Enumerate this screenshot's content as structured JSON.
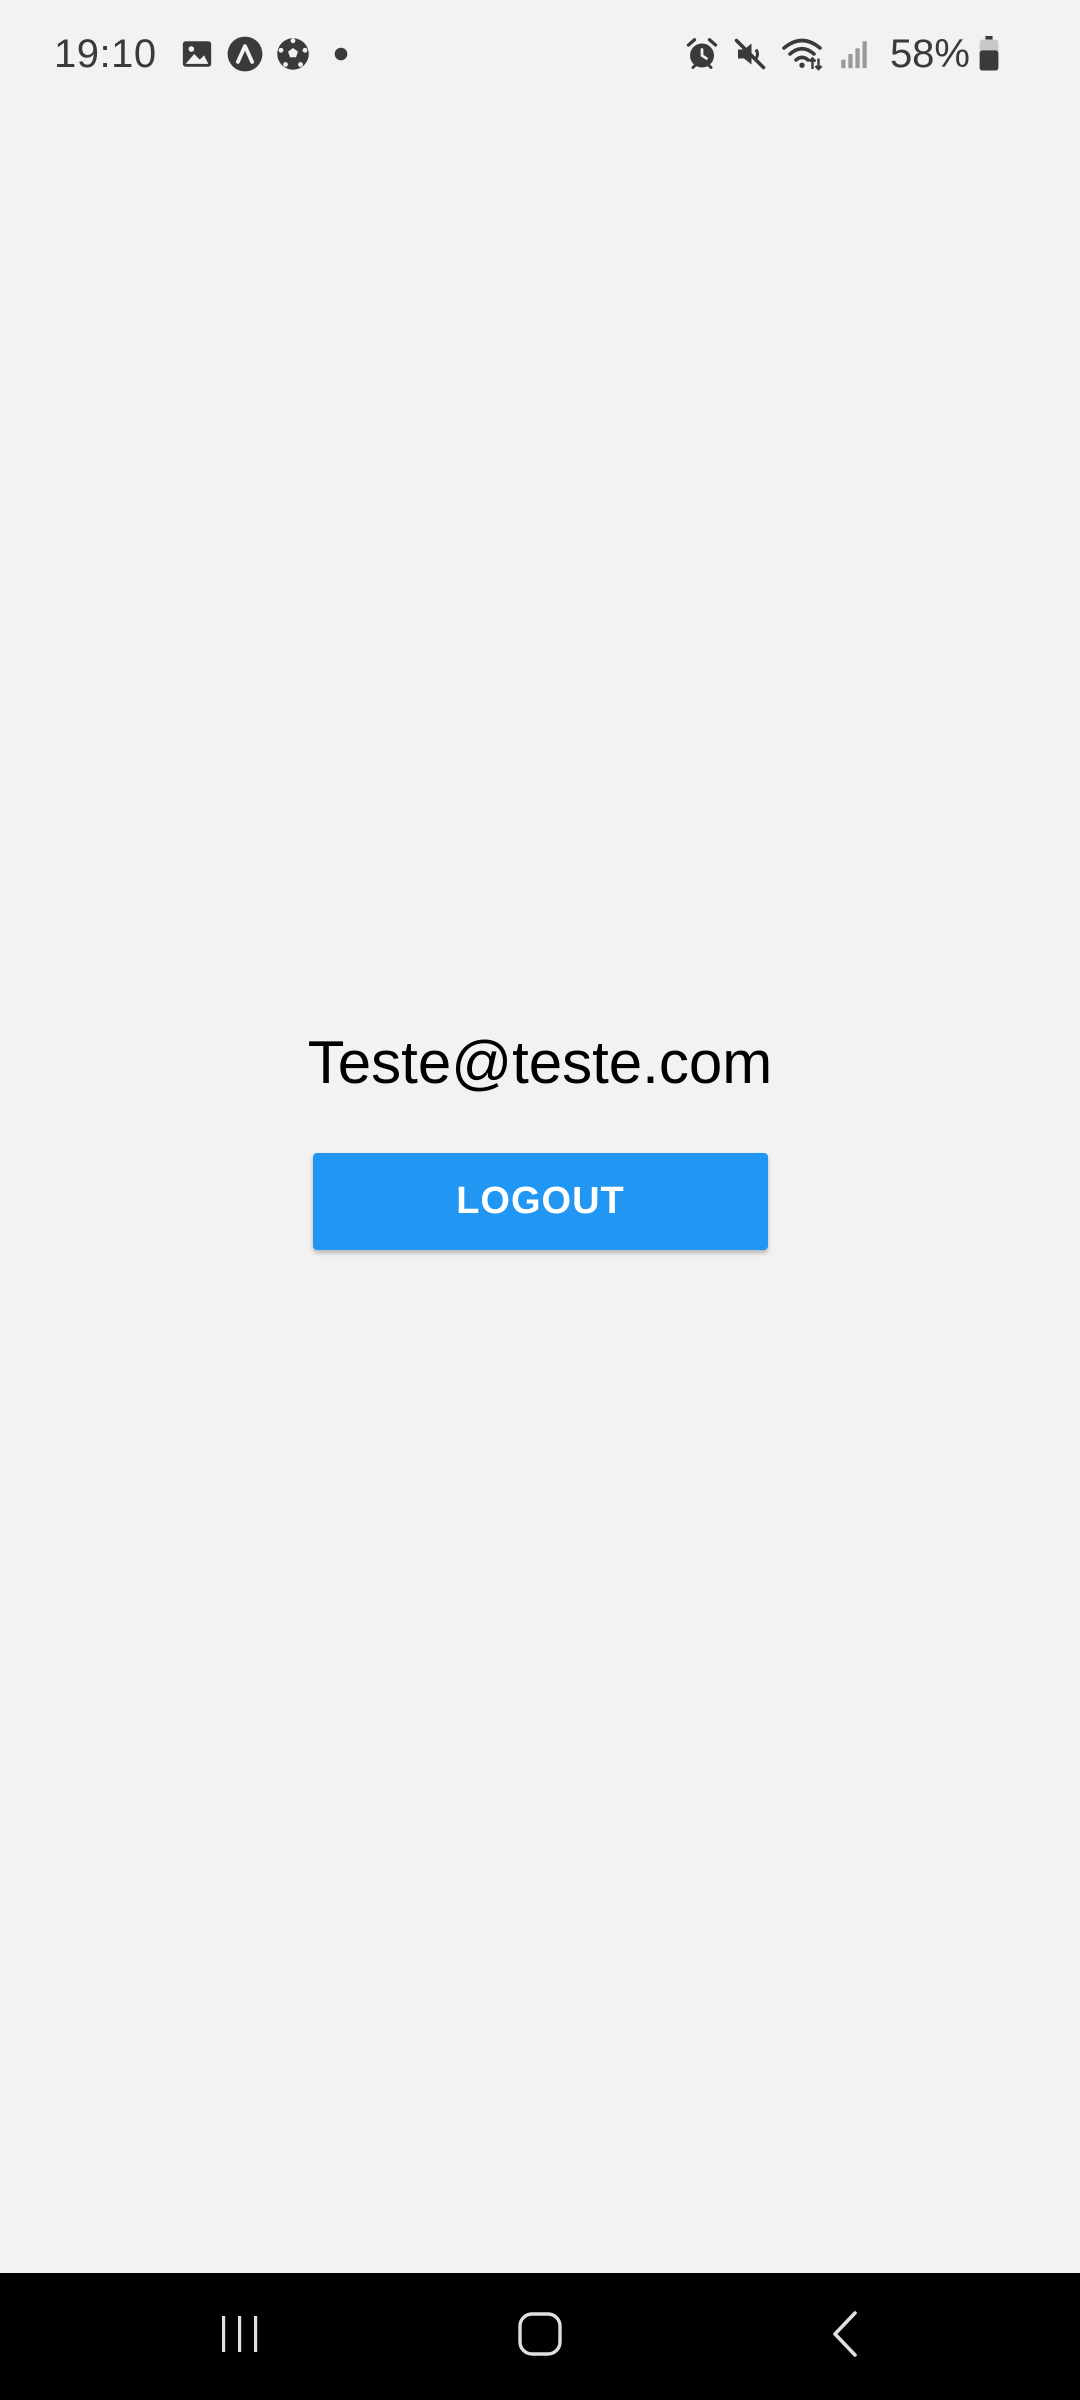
{
  "status_bar": {
    "time": "19:10",
    "battery_percent": "58%",
    "left_icons": [
      "gallery-icon",
      "app-lambda-icon",
      "soccer-ball-icon",
      "notification-dot-icon"
    ],
    "right_icons": [
      "alarm-icon",
      "mute-icon",
      "wifi-icon",
      "signal-icon",
      "battery-icon"
    ]
  },
  "main": {
    "user_email": "Teste@teste.com",
    "logout_label": "LOGOUT"
  },
  "colors": {
    "background": "#f2f2f2",
    "button": "#2196f3",
    "button_text": "#ffffff",
    "nav_bar": "#000000"
  },
  "nav_bar": {
    "buttons": [
      "recent-apps-icon",
      "home-icon",
      "back-icon"
    ]
  }
}
